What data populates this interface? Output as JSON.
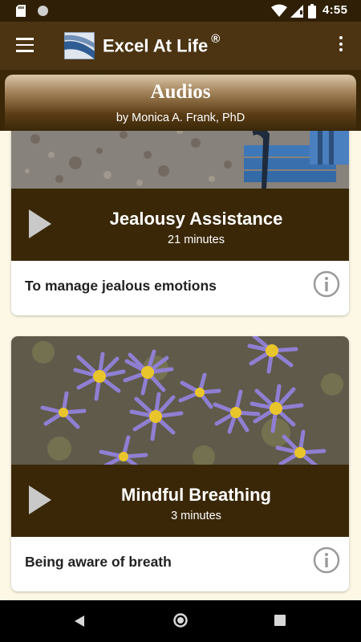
{
  "status_bar": {
    "time": "4:55"
  },
  "app_bar": {
    "title": "Excel At Life",
    "title_mark": "®"
  },
  "header": {
    "title": "Audios",
    "subtitle": "by Monica A. Frank, PhD"
  },
  "tracks": [
    {
      "title": "Jealousy Assistance",
      "duration": "21 minutes",
      "description": "To manage jealous emotions"
    },
    {
      "title": "Mindful Breathing",
      "duration": "3 minutes",
      "description": "Being aware of breath"
    }
  ],
  "colors": {
    "app_bar": "#4c3413",
    "player": "#3a2707",
    "background": "#fdf8e6"
  }
}
